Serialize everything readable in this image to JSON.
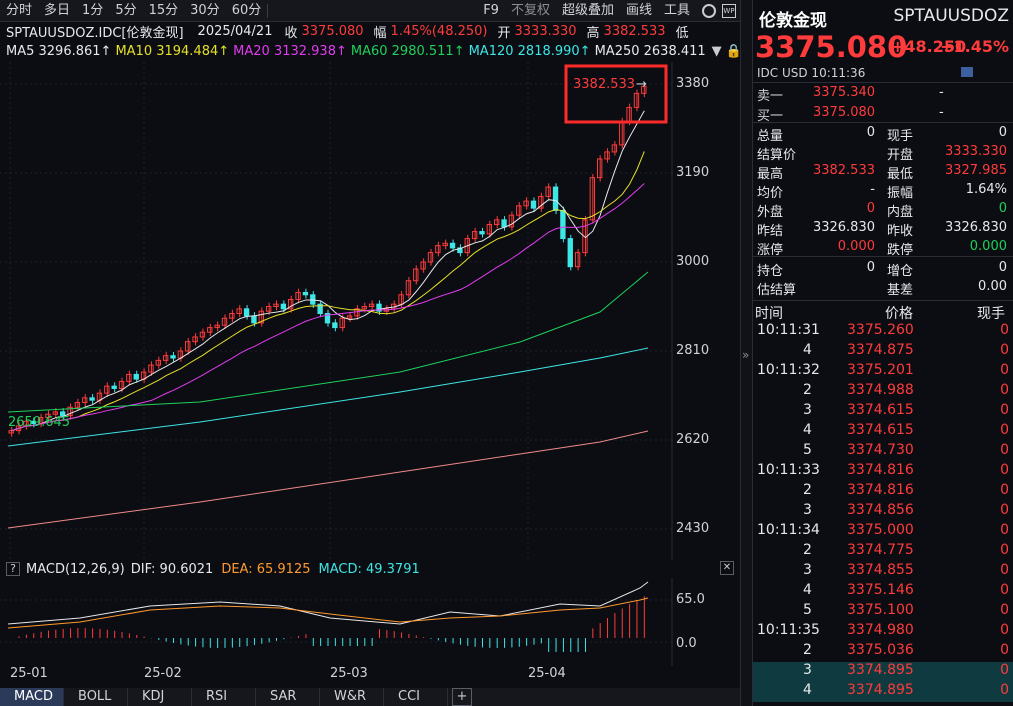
{
  "toolbar": {
    "periods": [
      "分时",
      "多日",
      "1分",
      "5分",
      "15分",
      "30分",
      "60分"
    ],
    "right_items": [
      "F9",
      "不复权",
      "超级叠加",
      "画线",
      "工具"
    ]
  },
  "info": {
    "symbol_label": "SPTAUUSDOZ.IDC[伦敦金现]",
    "date": "2025/04/21",
    "close_label": "收",
    "close": "3375.080",
    "range_label": "幅",
    "range": "1.45%(48.250)",
    "open_label": "开",
    "open": "3333.330",
    "high_label": "高",
    "high": "3382.533",
    "low_label": "低"
  },
  "ma": {
    "ma5": "MA5 3296.861↑",
    "ma10": "MA10 3194.484↑",
    "ma20": "MA20 3132.938↑",
    "ma60": "MA60 2980.511↑",
    "ma120": "MA120 2818.990↑",
    "ma250": "MA250 2638.411"
  },
  "chart": {
    "y_labels": [
      "3380",
      "3190",
      "3000",
      "2810",
      "2620",
      "2430"
    ],
    "high_marker": "3382.533",
    "low_marker": "2659.645",
    "x_labels": [
      "25-01",
      "25-02",
      "25-03",
      "25-04"
    ]
  },
  "macd": {
    "title": "MACD(12,26,9)",
    "dif": "DIF: 90.6021",
    "dea": "DEA: 65.9125",
    "macd": "MACD: 49.3791",
    "y_labels": [
      "65.0",
      "0.0"
    ]
  },
  "bottom_tabs": [
    "MACD",
    "BOLL",
    "KDJ",
    "RSI",
    "SAR",
    "W&R",
    "CCI"
  ],
  "quote": {
    "name": "伦敦金现",
    "code": "SPTAUUSDOZ",
    "price": "3375.080",
    "change": "+48.250",
    "pct": "+1.45%",
    "sub": "IDC  USD  10:11:36",
    "sell1_label": "卖一",
    "sell1": "3375.340",
    "sell1_vol": "-",
    "buy1_label": "买一",
    "buy1": "3375.080",
    "buy1_vol": "-",
    "stats": [
      [
        "总量",
        "0",
        "现手",
        "0"
      ],
      [
        "结算价",
        "",
        "开盘",
        "3333.330"
      ],
      [
        "最高",
        "3382.533",
        "最低",
        "3327.985"
      ],
      [
        "均价",
        "-",
        "振幅",
        "1.64%"
      ],
      [
        "外盘",
        "0",
        "内盘",
        "0"
      ],
      [
        "昨结",
        "3326.830",
        "昨收",
        "3326.830"
      ],
      [
        "涨停",
        "0.000",
        "跌停",
        "0.000"
      ]
    ],
    "stats2": [
      [
        "持仓",
        "0",
        "增仓",
        "0"
      ],
      [
        "估结算",
        "",
        "基差",
        "0.00"
      ]
    ],
    "ticks_header": [
      "时间",
      "价格",
      "现手"
    ],
    "ticks": [
      [
        "10:11:31",
        "3375.260",
        "0"
      ],
      [
        "4",
        "3374.875",
        "0"
      ],
      [
        "10:11:32",
        "3375.201",
        "0"
      ],
      [
        "2",
        "3374.988",
        "0"
      ],
      [
        "3",
        "3374.615",
        "0"
      ],
      [
        "4",
        "3374.615",
        "0"
      ],
      [
        "5",
        "3374.730",
        "0"
      ],
      [
        "10:11:33",
        "3374.816",
        "0"
      ],
      [
        "2",
        "3374.816",
        "0"
      ],
      [
        "3",
        "3374.856",
        "0"
      ],
      [
        "10:11:34",
        "3375.000",
        "0"
      ],
      [
        "2",
        "3374.775",
        "0"
      ],
      [
        "3",
        "3374.855",
        "0"
      ],
      [
        "4",
        "3375.146",
        "0"
      ],
      [
        "5",
        "3375.100",
        "0"
      ],
      [
        "10:11:35",
        "3374.980",
        "0"
      ],
      [
        "2",
        "3375.036",
        "0"
      ],
      [
        "3",
        "3374.895",
        "0"
      ],
      [
        "4",
        "3374.895",
        "0"
      ]
    ]
  }
}
